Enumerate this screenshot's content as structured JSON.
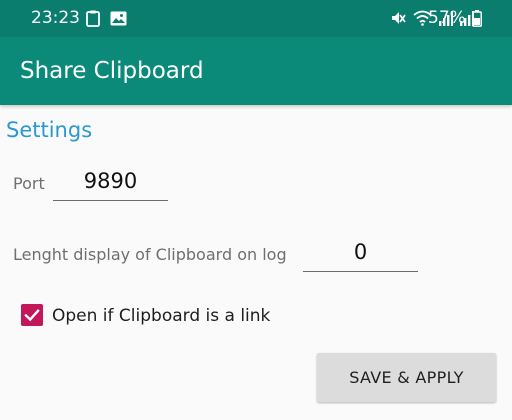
{
  "status_bar": {
    "time": "23:23",
    "battery_percent": "57%",
    "left_icons": [
      "clipboard-icon",
      "image-icon"
    ],
    "right_icons": [
      "mute-icon",
      "wifi-icon",
      "signal-icon",
      "signal-icon",
      "battery-icon"
    ]
  },
  "app_bar": {
    "title": "Share Clipboard",
    "color": "#0b8a7a"
  },
  "settings": {
    "section_title": "Settings",
    "port": {
      "label": "Port",
      "value": "9890"
    },
    "length_display": {
      "label": "Lenght display of Clipboard on log",
      "value": "0"
    },
    "open_link": {
      "label": "Open if Clipboard is a link",
      "checked": true
    },
    "save_button_label": "SAVE & APPLY"
  },
  "colors": {
    "accent": "#c2185b",
    "section_title": "#2a99cf",
    "status_bar": "#0b7d6e"
  }
}
